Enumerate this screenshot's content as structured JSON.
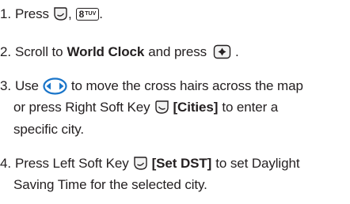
{
  "steps": [
    {
      "number": "1.",
      "text_a": "Press",
      "text_b": ",",
      "text_c": "."
    },
    {
      "number": "2.",
      "text_a": "Scroll to",
      "bold": "World Clock",
      "text_b": "and press",
      "text_c": "."
    },
    {
      "number": "3.",
      "line1_a": "Use",
      "line1_b": "to move the cross hairs across the map",
      "line2_a": "or press Right Soft Key",
      "line2_bold": "[Cities]",
      "line2_b": "to enter a",
      "line3": "specific city."
    },
    {
      "number": "4.",
      "line1_a": "Press Left Soft Key",
      "line1_bold": "[Set DST]",
      "line1_b": "to set Daylight",
      "line2": "Saving Time for the selected city."
    }
  ],
  "keys": {
    "eight_digit": "8",
    "eight_letters": "TUV"
  },
  "icons": {
    "left_soft_key": "left-soft-key-icon",
    "right_soft_key": "right-soft-key-icon",
    "eight_key": "eight-tuv-key-icon",
    "ok_key": "ok-key-icon",
    "nav_left_right": "navigation-left-right-key-icon"
  },
  "colors": {
    "text": "#231f20",
    "nav_key_blue": "#1a75c9"
  }
}
